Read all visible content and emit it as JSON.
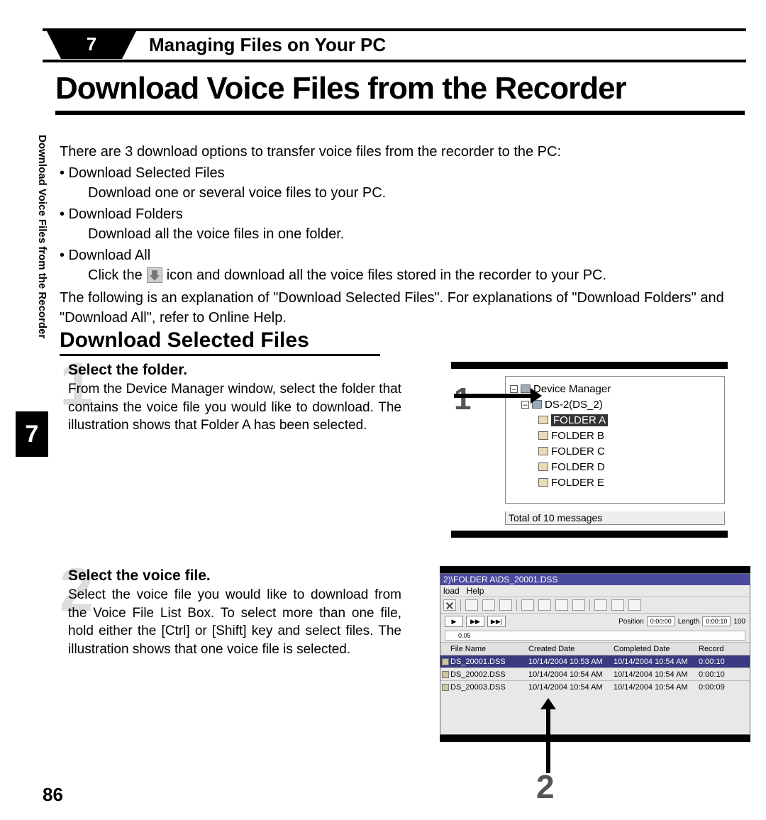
{
  "chapter": {
    "number": "7",
    "title": "Managing Files on Your PC"
  },
  "side_label": "Download Voice Files from the Recorder",
  "side_tab": "7",
  "page_title": "Download Voice Files from the Recorder",
  "intro": {
    "lead": "There are 3 download options to transfer voice files from the recorder to the PC:",
    "opt1": "• Download Selected Files",
    "opt1_sub": "Download one or several voice files to your PC.",
    "opt2": "• Download Folders",
    "opt2_sub": "Download all the voice files in one folder.",
    "opt3": "• Download All",
    "opt3_sub_a": "Click the",
    "opt3_sub_b": "icon and download all the voice files stored in the recorder to your PC.",
    "tail": "The following is an explanation of \"Download Selected Files\". For explanations of \"Download Folders\" and \"Download All\", refer to Online Help."
  },
  "section_title": "Download Selected Files",
  "steps": {
    "s1": {
      "num": "1",
      "head": "Select the folder.",
      "text": "From the Device Manager window, select the folder that contains the voice file you would like to download. The illustration shows that Folder A has been selected."
    },
    "s2": {
      "num": "2",
      "head": "Select the voice file.",
      "text": "Select the voice file you would like to download from the Voice File List Box. To select more than one file, hold either the [Ctrl] or [Shift] key and select files. The illustration shows that one voice file is selected."
    }
  },
  "fig1": {
    "callout": "1",
    "root": "Device Manager",
    "device": "DS-2(DS_2)",
    "folders": [
      "FOLDER A",
      "FOLDER B",
      "FOLDER C",
      "FOLDER D",
      "FOLDER E"
    ],
    "status": "Total of 10 messages"
  },
  "fig2": {
    "callout": "2",
    "title": "2)\\FOLDER A\\DS_20001.DSS",
    "menu": {
      "m1": "load",
      "m2": "Help"
    },
    "play_labels": {
      "pos": "Position",
      "len": "Length",
      "pos_v": "0:00:00",
      "len_v": "0:00:10",
      "vol": "100"
    },
    "ruler_tick": "0.05",
    "cols": {
      "c1": "File Name",
      "c2": "Created Date",
      "c3": "Completed Date",
      "c4": "Record"
    },
    "rows": [
      {
        "name": "DS_20001.DSS",
        "created": "10/14/2004 10:53 AM",
        "completed": "10/14/2004 10:54 AM",
        "rec": "0:00:10"
      },
      {
        "name": "DS_20002.DSS",
        "created": "10/14/2004 10:54 AM",
        "completed": "10/14/2004 10:54 AM",
        "rec": "0:00:10"
      },
      {
        "name": "DS_20003.DSS",
        "created": "10/14/2004 10:54 AM",
        "completed": "10/14/2004 10:54 AM",
        "rec": "0:00:09"
      }
    ]
  },
  "page_number": "86"
}
